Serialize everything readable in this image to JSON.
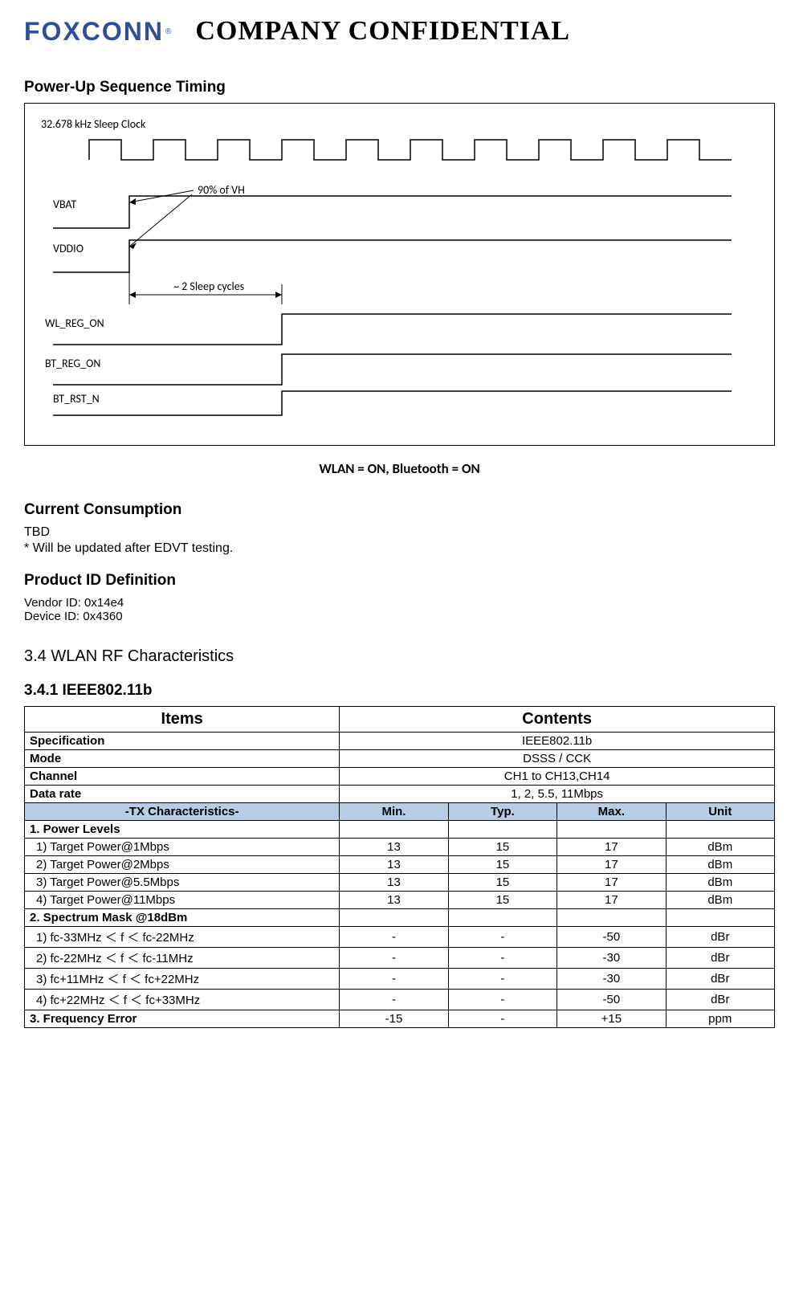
{
  "header": {
    "logo_text": "FOXCONN",
    "logo_reg": "®",
    "confidential": "COMPANY  CONFIDENTIAL"
  },
  "sections": {
    "powerup_title": "Power-Up Sequence Timing",
    "current_title": "Current Consumption",
    "current_body1": "TBD",
    "current_body2": "* Will be updated after EDVT testing.",
    "product_title": "Product ID Definition",
    "vendor_id": "Vendor ID: 0x14e4",
    "device_id": "Device ID: 0x4360",
    "rf_title": "3.4 WLAN RF Characteristics",
    "ieee_title": "3.4.1 IEEE802.11b"
  },
  "diagram": {
    "caption": "WLAN = ON, Bluetooth = ON",
    "clock_label": "32.678  kHz Sleep Clock",
    "vbat": "VBAT",
    "vddio": "VDDIO",
    "wl_reg": "WL_REG_ON",
    "bt_reg": "BT_REG_ON",
    "bt_rst": "BT_RST_N",
    "note_90": "90% of VH",
    "note_sleep": "~ 2 Sleep cycles"
  },
  "table": {
    "hdr_items": "Items",
    "hdr_contents": "Contents",
    "rows_top": [
      {
        "label": "Specification",
        "value": "IEEE802.11b"
      },
      {
        "label": "Mode",
        "value": "DSSS / CCK"
      },
      {
        "label": "Channel",
        "value": "CH1 to CH13,CH14"
      },
      {
        "label": "Data rate",
        "value": "1, 2, 5.5, 11Mbps"
      }
    ],
    "tx_header": {
      "label": "-TX Characteristics-",
      "c1": "Min.",
      "c2": "Typ.",
      "c3": "Max.",
      "c4": "Unit"
    },
    "groups": [
      {
        "heading": "1. Power Levels",
        "rows": [
          {
            "label": "1) Target Power@1Mbps",
            "min": "13",
            "typ": "15",
            "max": "17",
            "unit": "dBm"
          },
          {
            "label": "2) Target Power@2Mbps",
            "min": "13",
            "typ": "15",
            "max": "17",
            "unit": "dBm"
          },
          {
            "label": "3) Target Power@5.5Mbps",
            "min": "13",
            "typ": "15",
            "max": "17",
            "unit": "dBm"
          },
          {
            "label": "4) Target Power@11Mbps",
            "min": "13",
            "typ": "15",
            "max": "17",
            "unit": "dBm"
          }
        ]
      },
      {
        "heading": "2. Spectrum Mask @18dBm",
        "rows": [
          {
            "label": "1) fc-33MHz ＜ f ＜ fc-22MHz",
            "min": "-",
            "typ": "-",
            "max": "-50",
            "unit": "dBr"
          },
          {
            "label": "2) fc-22MHz ＜ f ＜ fc-11MHz",
            "min": "-",
            "typ": "-",
            "max": "-30",
            "unit": "dBr"
          },
          {
            "label": "3) fc+11MHz ＜ f ＜ fc+22MHz",
            "min": "-",
            "typ": "-",
            "max": "-30",
            "unit": "dBr"
          },
          {
            "label": "4) fc+22MHz ＜ f ＜ fc+33MHz",
            "min": "-",
            "typ": "-",
            "max": "-50",
            "unit": "dBr"
          }
        ]
      }
    ],
    "freq_error": {
      "label": "3. Frequency Error",
      "min": "-15",
      "typ": "-",
      "max": "+15",
      "unit": "ppm"
    }
  },
  "chart_data": {
    "type": "timing-diagram",
    "caption": "WLAN = ON, Bluetooth = ON",
    "signals": [
      {
        "name": "32.678 kHz Sleep Clock",
        "waveform": "periodic-square",
        "periods_shown": 10
      },
      {
        "name": "VBAT",
        "waveform": "rising-edge",
        "transitions": [
          {
            "t": 1,
            "to": "high"
          }
        ]
      },
      {
        "name": "VDDIO",
        "waveform": "rising-edge",
        "transitions": [
          {
            "t": 1,
            "to": "high"
          }
        ]
      },
      {
        "name": "WL_REG_ON",
        "waveform": "rising-edge",
        "transitions": [
          {
            "t": 3,
            "to": "high"
          }
        ]
      },
      {
        "name": "BT_REG_ON",
        "waveform": "rising-edge",
        "transitions": [
          {
            "t": 3,
            "to": "high"
          }
        ]
      },
      {
        "name": "BT_RST_N",
        "waveform": "rising-edge",
        "transitions": [
          {
            "t": 3,
            "to": "high"
          }
        ]
      }
    ],
    "annotations": [
      {
        "text": "90% of VH",
        "refers_to": "VBAT rising edge level"
      },
      {
        "text": "~ 2 Sleep cycles",
        "refers_to": "delay between VBAT/VDDIO rise and WL_REG_ON rise"
      }
    ]
  }
}
